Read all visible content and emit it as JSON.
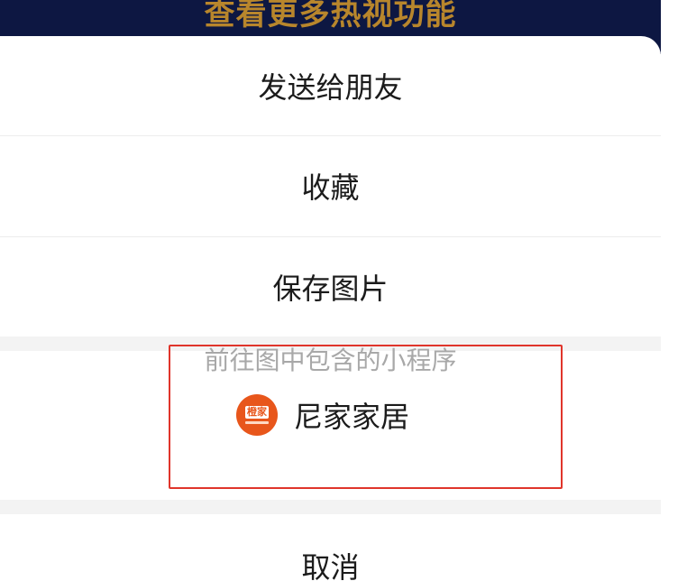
{
  "background_page": {
    "banner_text": "查看更多热视功能"
  },
  "share_sheet": {
    "items": [
      {
        "label": "发送给朋友"
      },
      {
        "label": "收藏"
      },
      {
        "label": "保存图片"
      }
    ],
    "mini_program": {
      "hint": "前往图中包含的小程序",
      "logo_text": "橙家",
      "name": "尼家家居"
    },
    "cancel_label": "取消"
  },
  "colors": {
    "backdrop": "#0d1742",
    "banner_text": "#b8862c",
    "highlight_border": "#e0352b",
    "logo_bg": "#e8561b"
  }
}
